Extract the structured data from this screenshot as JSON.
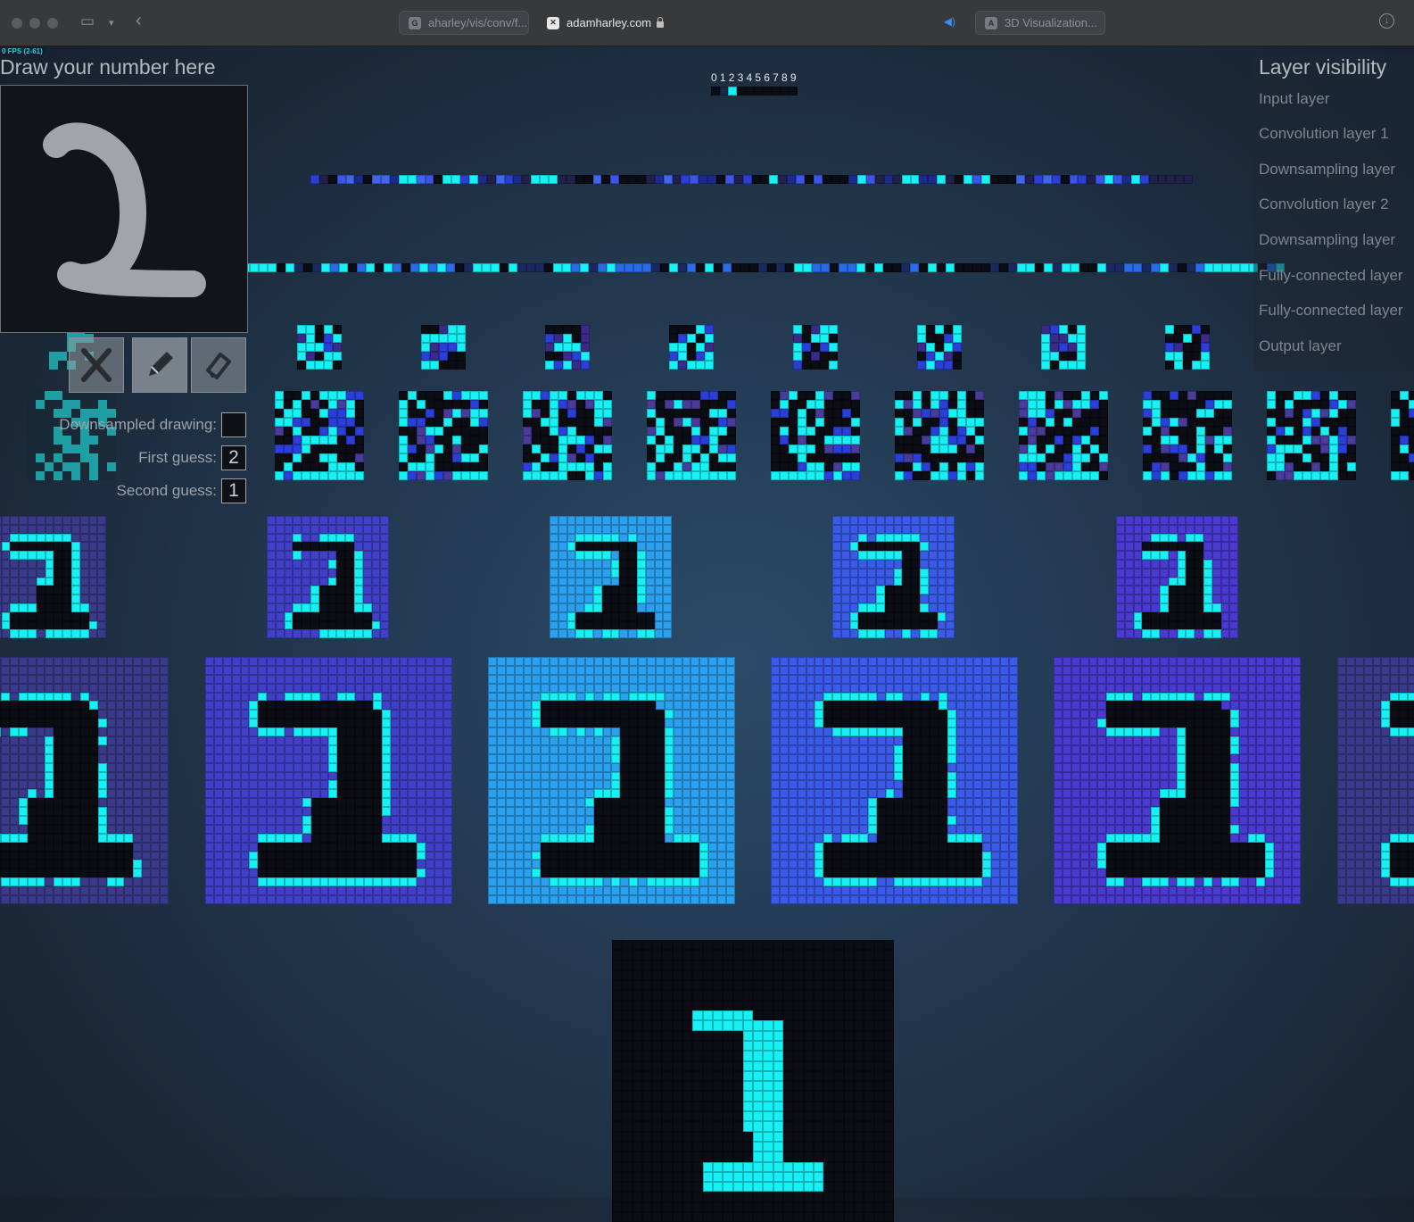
{
  "browser": {
    "tabs": [
      {
        "label": "aharley/vis/conv/f...",
        "favicon": "G"
      },
      {
        "label": "adamharley.com",
        "favicon": "✕"
      },
      {
        "label": "3D Visualization...",
        "favicon": "A"
      }
    ]
  },
  "fps": "0 FPS (2-61)",
  "drawing": {
    "title": "Draw your number here",
    "downsampled_label": "Downsampled drawing:",
    "first_guess_label": "First guess:",
    "first_guess_value": "2",
    "second_guess_label": "Second guess:",
    "second_guess_value": "1",
    "tools": [
      "clear-icon",
      "pencil-icon",
      "eraser-icon"
    ]
  },
  "output_digits": "0123456789",
  "layer_visibility": {
    "title": "Layer visibility",
    "items": [
      "Input layer",
      "Convolution layer 1",
      "Downsampling layer",
      "Convolution layer 2",
      "Downsampling layer",
      "Fully-connected layer",
      "Fully-connected layer",
      "Output layer"
    ]
  },
  "colors": {
    "cyan": "#16f1f5",
    "dark": "#0b0d14",
    "accent_blue": "#2aa0ee",
    "panel_text": "#9da2a8"
  }
}
